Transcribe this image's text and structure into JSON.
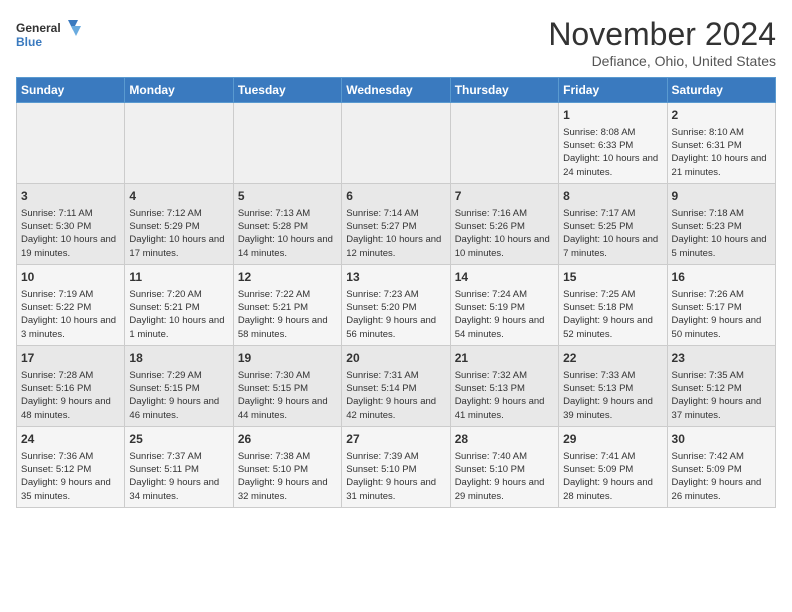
{
  "header": {
    "logo_line1": "General",
    "logo_line2": "Blue",
    "month": "November 2024",
    "location": "Defiance, Ohio, United States"
  },
  "days_of_week": [
    "Sunday",
    "Monday",
    "Tuesday",
    "Wednesday",
    "Thursday",
    "Friday",
    "Saturday"
  ],
  "weeks": [
    [
      {
        "day": "",
        "info": ""
      },
      {
        "day": "",
        "info": ""
      },
      {
        "day": "",
        "info": ""
      },
      {
        "day": "",
        "info": ""
      },
      {
        "day": "",
        "info": ""
      },
      {
        "day": "1",
        "info": "Sunrise: 8:08 AM\nSunset: 6:33 PM\nDaylight: 10 hours and 24 minutes."
      },
      {
        "day": "2",
        "info": "Sunrise: 8:10 AM\nSunset: 6:31 PM\nDaylight: 10 hours and 21 minutes."
      }
    ],
    [
      {
        "day": "3",
        "info": "Sunrise: 7:11 AM\nSunset: 5:30 PM\nDaylight: 10 hours and 19 minutes."
      },
      {
        "day": "4",
        "info": "Sunrise: 7:12 AM\nSunset: 5:29 PM\nDaylight: 10 hours and 17 minutes."
      },
      {
        "day": "5",
        "info": "Sunrise: 7:13 AM\nSunset: 5:28 PM\nDaylight: 10 hours and 14 minutes."
      },
      {
        "day": "6",
        "info": "Sunrise: 7:14 AM\nSunset: 5:27 PM\nDaylight: 10 hours and 12 minutes."
      },
      {
        "day": "7",
        "info": "Sunrise: 7:16 AM\nSunset: 5:26 PM\nDaylight: 10 hours and 10 minutes."
      },
      {
        "day": "8",
        "info": "Sunrise: 7:17 AM\nSunset: 5:25 PM\nDaylight: 10 hours and 7 minutes."
      },
      {
        "day": "9",
        "info": "Sunrise: 7:18 AM\nSunset: 5:23 PM\nDaylight: 10 hours and 5 minutes."
      }
    ],
    [
      {
        "day": "10",
        "info": "Sunrise: 7:19 AM\nSunset: 5:22 PM\nDaylight: 10 hours and 3 minutes."
      },
      {
        "day": "11",
        "info": "Sunrise: 7:20 AM\nSunset: 5:21 PM\nDaylight: 10 hours and 1 minute."
      },
      {
        "day": "12",
        "info": "Sunrise: 7:22 AM\nSunset: 5:21 PM\nDaylight: 9 hours and 58 minutes."
      },
      {
        "day": "13",
        "info": "Sunrise: 7:23 AM\nSunset: 5:20 PM\nDaylight: 9 hours and 56 minutes."
      },
      {
        "day": "14",
        "info": "Sunrise: 7:24 AM\nSunset: 5:19 PM\nDaylight: 9 hours and 54 minutes."
      },
      {
        "day": "15",
        "info": "Sunrise: 7:25 AM\nSunset: 5:18 PM\nDaylight: 9 hours and 52 minutes."
      },
      {
        "day": "16",
        "info": "Sunrise: 7:26 AM\nSunset: 5:17 PM\nDaylight: 9 hours and 50 minutes."
      }
    ],
    [
      {
        "day": "17",
        "info": "Sunrise: 7:28 AM\nSunset: 5:16 PM\nDaylight: 9 hours and 48 minutes."
      },
      {
        "day": "18",
        "info": "Sunrise: 7:29 AM\nSunset: 5:15 PM\nDaylight: 9 hours and 46 minutes."
      },
      {
        "day": "19",
        "info": "Sunrise: 7:30 AM\nSunset: 5:15 PM\nDaylight: 9 hours and 44 minutes."
      },
      {
        "day": "20",
        "info": "Sunrise: 7:31 AM\nSunset: 5:14 PM\nDaylight: 9 hours and 42 minutes."
      },
      {
        "day": "21",
        "info": "Sunrise: 7:32 AM\nSunset: 5:13 PM\nDaylight: 9 hours and 41 minutes."
      },
      {
        "day": "22",
        "info": "Sunrise: 7:33 AM\nSunset: 5:13 PM\nDaylight: 9 hours and 39 minutes."
      },
      {
        "day": "23",
        "info": "Sunrise: 7:35 AM\nSunset: 5:12 PM\nDaylight: 9 hours and 37 minutes."
      }
    ],
    [
      {
        "day": "24",
        "info": "Sunrise: 7:36 AM\nSunset: 5:12 PM\nDaylight: 9 hours and 35 minutes."
      },
      {
        "day": "25",
        "info": "Sunrise: 7:37 AM\nSunset: 5:11 PM\nDaylight: 9 hours and 34 minutes."
      },
      {
        "day": "26",
        "info": "Sunrise: 7:38 AM\nSunset: 5:10 PM\nDaylight: 9 hours and 32 minutes."
      },
      {
        "day": "27",
        "info": "Sunrise: 7:39 AM\nSunset: 5:10 PM\nDaylight: 9 hours and 31 minutes."
      },
      {
        "day": "28",
        "info": "Sunrise: 7:40 AM\nSunset: 5:10 PM\nDaylight: 9 hours and 29 minutes."
      },
      {
        "day": "29",
        "info": "Sunrise: 7:41 AM\nSunset: 5:09 PM\nDaylight: 9 hours and 28 minutes."
      },
      {
        "day": "30",
        "info": "Sunrise: 7:42 AM\nSunset: 5:09 PM\nDaylight: 9 hours and 26 minutes."
      }
    ]
  ]
}
